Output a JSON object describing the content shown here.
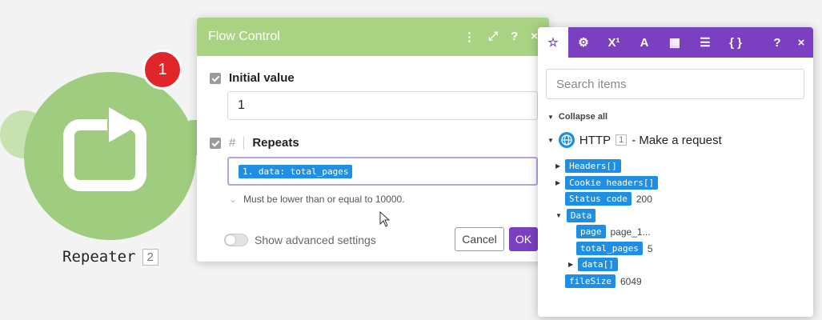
{
  "node": {
    "label": "Repeater",
    "number": "2",
    "badge": "1"
  },
  "dialog": {
    "title": "Flow Control",
    "initial_value_label": "Initial value",
    "initial_value": "1",
    "repeats_label": "Repeats",
    "repeats_prefix": "#",
    "repeats_value": "1. data: total_pages",
    "hint": "Must be lower than or equal to 10000.",
    "advanced_label": "Show advanced settings",
    "cancel_label": "Cancel",
    "ok_label": "OK"
  },
  "panel": {
    "tabs": [
      "star",
      "gear",
      "X¹",
      "A",
      "calendar",
      "table",
      "{ }"
    ],
    "search_placeholder": "Search items",
    "collapse_all": "Collapse all",
    "module_name": "HTTP",
    "module_number": "1",
    "module_action": "- Make a request",
    "items": [
      {
        "key": "Headers[]",
        "value": ""
      },
      {
        "key": "Cookie headers[]",
        "value": ""
      },
      {
        "key": "Status code",
        "value": "200"
      },
      {
        "key": "Data",
        "value": ""
      },
      {
        "key": "page",
        "value": "page_1..."
      },
      {
        "key": "total_pages",
        "value": "5"
      },
      {
        "key": "data[]",
        "value": ""
      },
      {
        "key": "fileSize",
        "value": "6049"
      }
    ]
  },
  "colors": {
    "node_green": "#9fcc7e",
    "header_green": "#a9d283",
    "purple": "#7b3fc1",
    "pill_blue": "#1f8fe6",
    "badge_red": "#e0262b"
  }
}
